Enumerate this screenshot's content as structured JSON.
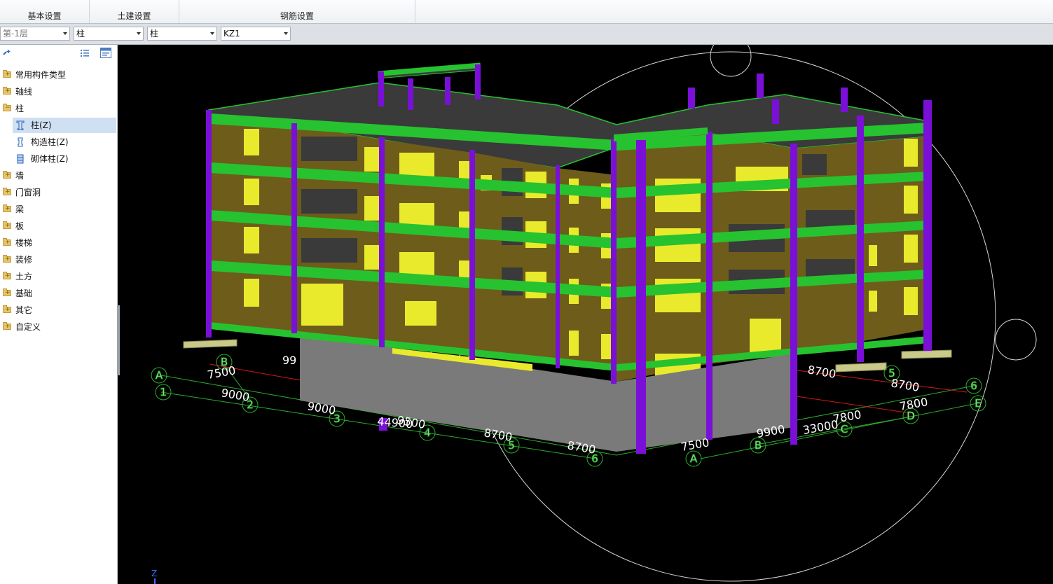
{
  "ribbon": {
    "groups": [
      {
        "label": "基本设置"
      },
      {
        "label": "土建设置"
      },
      {
        "label": "钢筋设置"
      }
    ]
  },
  "toolbar": {
    "floor": "第-1层",
    "category": "柱",
    "type": "柱",
    "component": "KZ1"
  },
  "tree": {
    "items": [
      {
        "label": "常用构件类型"
      },
      {
        "label": "轴线"
      },
      {
        "label": "柱"
      },
      {
        "label": "柱(Z)"
      },
      {
        "label": "构造柱(Z)"
      },
      {
        "label": "砌体柱(Z)"
      },
      {
        "label": "墙"
      },
      {
        "label": "门窗洞"
      },
      {
        "label": "梁"
      },
      {
        "label": "板"
      },
      {
        "label": "楼梯"
      },
      {
        "label": "装修"
      },
      {
        "label": "土方"
      },
      {
        "label": "基础"
      },
      {
        "label": "其它"
      },
      {
        "label": "自定义"
      }
    ]
  },
  "viewport": {
    "axis_bubbles_front": [
      "A",
      "1",
      "B",
      "2",
      "3",
      "4",
      "5",
      "6"
    ],
    "axis_bubbles_right": [
      "A",
      "B",
      "C",
      "D",
      "E",
      "5",
      "6"
    ],
    "dims_front": [
      "7500",
      "9000",
      "9000",
      "9500",
      "44900",
      "8700",
      "8700",
      "99"
    ],
    "dims_right": [
      "7500",
      "9900",
      "33000",
      "7800",
      "7800",
      "8700",
      "8700"
    ],
    "axis_indicator": "Z",
    "colors": {
      "column": "#7a10d8",
      "beam": "#27c230",
      "wall": "#6e5c1a",
      "window": "#eaea2c",
      "slab": "#3a3a3a",
      "basement": "#7a7a7a",
      "foundation": "#c9c98a",
      "background": "#000000"
    }
  }
}
